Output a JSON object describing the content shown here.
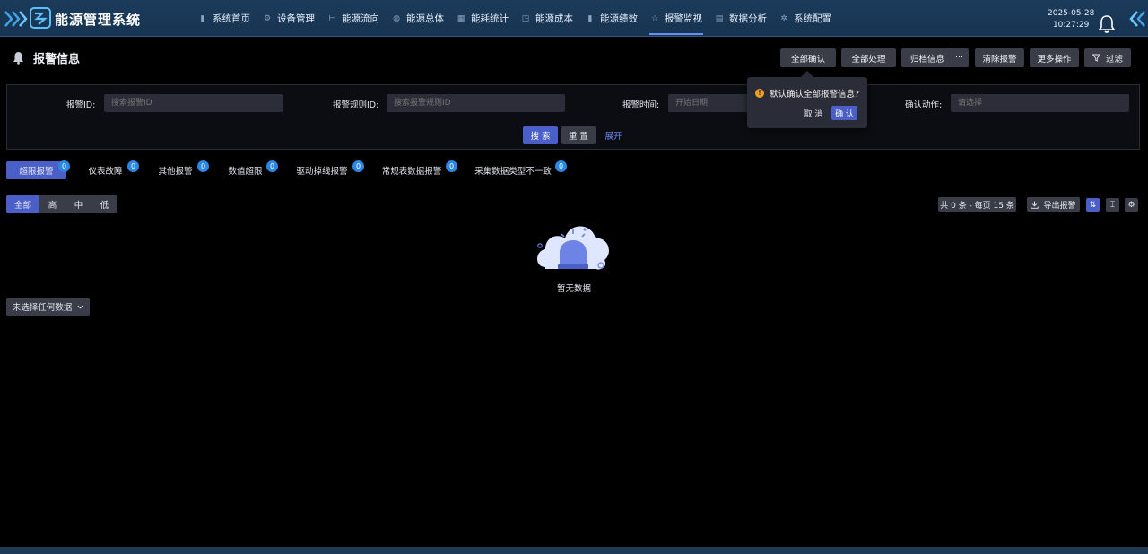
{
  "header": {
    "app_title": "能源管理系统",
    "date": "2025-05-28",
    "time": "10:27:29",
    "nav": [
      {
        "label": "系统首页",
        "icon": "bar-chart-icon"
      },
      {
        "label": "设备管理",
        "icon": "device-icon"
      },
      {
        "label": "能源流向",
        "icon": "flow-icon"
      },
      {
        "label": "能源总体",
        "icon": "database-icon"
      },
      {
        "label": "能耗统计",
        "icon": "grid-icon"
      },
      {
        "label": "能源成本",
        "icon": "cost-icon"
      },
      {
        "label": "能源绩效",
        "icon": "bar-chart-icon"
      },
      {
        "label": "报警监视",
        "icon": "star-icon"
      },
      {
        "label": "数据分析",
        "icon": "chart-icon"
      },
      {
        "label": "系统配置",
        "icon": "gear-icon"
      }
    ],
    "active_nav": "报警监视"
  },
  "page": {
    "title": "报警信息",
    "toolbar": {
      "confirm_all": "全部确认",
      "process_all": "全部处理",
      "archive": "归档信息",
      "more_dots": "···",
      "clear": "清除报警",
      "more_ops": "更多操作",
      "filter": "过滤"
    },
    "popconfirm": {
      "message": "默认确认全部报警信息?",
      "cancel": "取 消",
      "ok": "确 认"
    }
  },
  "filters": {
    "alarm_id_label": "报警ID:",
    "alarm_id_placeholder": "搜索报警ID",
    "rule_id_label": "报警规则ID:",
    "rule_id_placeholder": "搜索报警规则ID",
    "time_label": "报警时间:",
    "time_placeholder": "开始日期",
    "action_label": "确认动作:",
    "action_placeholder": "请选择",
    "search": "搜 索",
    "reset": "重 置",
    "expand": "展开"
  },
  "tabs": [
    {
      "label": "超限报警",
      "count": "0"
    },
    {
      "label": "仪表故障",
      "count": "0"
    },
    {
      "label": "其他报警",
      "count": "0"
    },
    {
      "label": "数值超限",
      "count": "0"
    },
    {
      "label": "驱动掉线报警",
      "count": "0"
    },
    {
      "label": "常规表数据报警",
      "count": "0"
    },
    {
      "label": "采集数据类型不一致",
      "count": "0"
    }
  ],
  "levels": [
    "全部",
    "高",
    "中",
    "低"
  ],
  "table": {
    "total": "共 0 条 - 每页 15 条",
    "export": "导出报警",
    "empty": "暂无数据",
    "selection": "未选择任何数据"
  },
  "colors": {
    "primary": "#4a5fc8",
    "badge": "#2b87e3",
    "header_bg": "#1c3a5a",
    "warning": "#f0a020"
  }
}
